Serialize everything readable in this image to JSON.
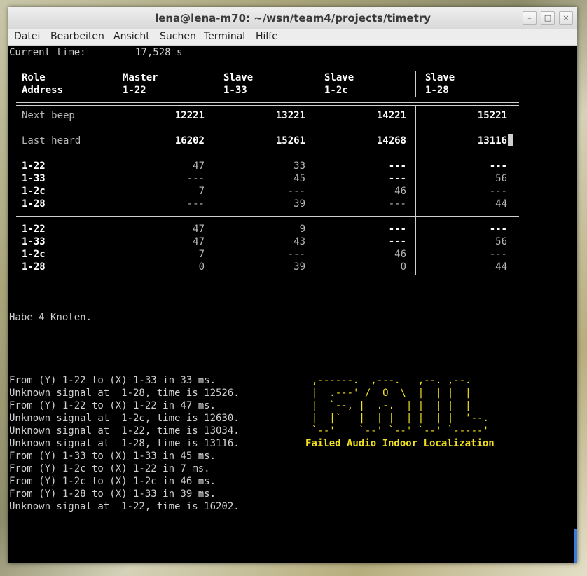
{
  "window": {
    "title": "lena@lena-m70: ~/wsn/team4/projects/timetry",
    "buttons": [
      "–",
      "□",
      "×"
    ]
  },
  "menu": [
    "Datei",
    "Bearbeiten",
    "Ansicht",
    "Suchen",
    "Terminal",
    "Hilfe"
  ],
  "terminal": {
    "current_time_label": "Current time:",
    "current_time_value": "17,528 s",
    "table": {
      "header_row1": [
        "Role",
        "Master",
        "Slave",
        "Slave",
        "Slave"
      ],
      "header_row2": [
        "Address",
        "1-22",
        "1-33",
        "1-2c",
        "1-28"
      ],
      "next_beep": {
        "label": "Next beep",
        "values": [
          "12221",
          "13221",
          "14221",
          "15221"
        ]
      },
      "last_heard": {
        "label": "Last heard",
        "values": [
          "16202",
          "15261",
          "14268",
          "13116"
        ]
      },
      "block1": [
        {
          "addr": "1-22",
          "values": [
            "47",
            "33",
            "---",
            "---"
          ]
        },
        {
          "addr": "1-33",
          "values": [
            "---",
            "45",
            "---",
            "56"
          ]
        },
        {
          "addr": "1-2c",
          "values": [
            "7",
            "---",
            "46",
            "---"
          ]
        },
        {
          "addr": "1-28",
          "values": [
            "---",
            "39",
            "---",
            "44"
          ]
        }
      ],
      "block2": [
        {
          "addr": "1-22",
          "values": [
            "47",
            "9",
            "---",
            "---"
          ]
        },
        {
          "addr": "1-33",
          "values": [
            "47",
            "43",
            "---",
            "56"
          ]
        },
        {
          "addr": "1-2c",
          "values": [
            "7",
            "---",
            "46",
            "---"
          ]
        },
        {
          "addr": "1-28",
          "values": [
            "0",
            "39",
            "0",
            "44"
          ]
        }
      ]
    },
    "nodes_line": "Habe 4 Knoten.",
    "log": [
      "From (Y) 1-22 to (X) 1-33 in 33 ms.",
      "Unknown signal at  1-28, time is 12526.",
      "From (Y) 1-22 to (X) 1-22 in 47 ms.",
      "Unknown signal at  1-2c, time is 12630.",
      "Unknown signal at  1-22, time is 13034.",
      "Unknown signal at  1-28, time is 13116.",
      "From (Y) 1-33 to (X) 1-33 in 45 ms.",
      "From (Y) 1-2c to (X) 1-22 in 7 ms.",
      "From (Y) 1-2c to (X) 1-2c in 46 ms.",
      "From (Y) 1-28 to (X) 1-33 in 39 ms.",
      "Unknown signal at  1-22, time is 16202."
    ],
    "ascii_art": [
      ",------.  ,---.   ,--. ,--.",
      "|  .---' /  O  \\  |  | |  |",
      "|  `--, |  .-.  | |  | |  |",
      "|  |`   |  | |  | |  | |  '--.",
      "`--'    `--' `--' `--' `-----'"
    ],
    "ascii_caption": "Failed Audio Indoor Localization"
  },
  "colors": {
    "ascii_yellow": "#f2e11c",
    "terminal_bg": "#000000",
    "scrollbar": "#3a7dd8"
  }
}
